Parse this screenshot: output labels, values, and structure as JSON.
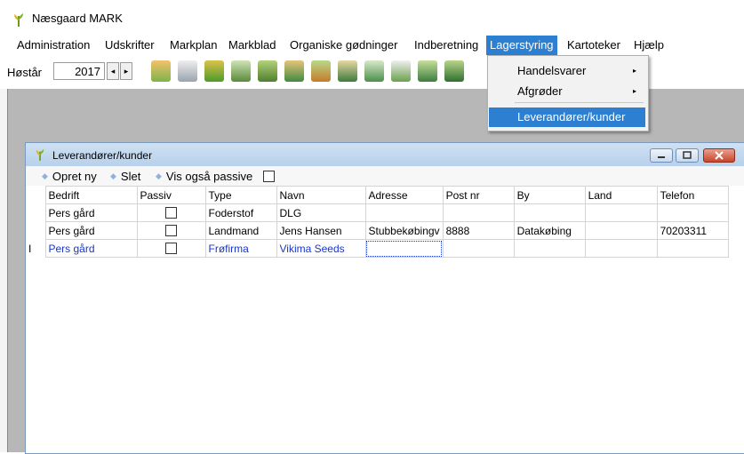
{
  "app": {
    "title": "Næsgaard MARK",
    "icon": "wheat-logo-icon"
  },
  "menu": {
    "items": [
      {
        "label": "Administration"
      },
      {
        "label": "Udskrifter"
      },
      {
        "label": "Markplan"
      },
      {
        "label": "Markblad"
      },
      {
        "label": "Organiske gødninger"
      },
      {
        "label": "Indberetning"
      },
      {
        "label": "Lagerstyring",
        "active": true
      },
      {
        "label": "Kartoteker"
      },
      {
        "label": "Hjælp"
      }
    ]
  },
  "toolbar": {
    "harvest_label": "Høstår",
    "year": "2017",
    "prev": "◂",
    "next": "▸"
  },
  "dropdown": {
    "items": [
      {
        "label": "Handelsvarer",
        "submenu": "▸"
      },
      {
        "label": "Afgrøder",
        "submenu": "▸"
      },
      {
        "label": "Leverandører/kunder",
        "selected": true
      }
    ]
  },
  "window": {
    "title": "Leverandører/kunder",
    "actions": {
      "new": "Opret ny",
      "delete": "Slet",
      "show_passive": "Vis også passive"
    },
    "columns": [
      "Bedrift",
      "Passiv",
      "Type",
      "Navn",
      "Adresse",
      "Post nr",
      "By",
      "Land",
      "Telefon"
    ],
    "current_marker": "I",
    "rows": [
      {
        "bedrift": "Pers gård",
        "type": "Foderstof",
        "navn": "DLG",
        "adresse": "",
        "postnr": "",
        "by": "",
        "land": "",
        "telefon": ""
      },
      {
        "bedrift": "Pers gård",
        "type": "Landmand",
        "navn": "Jens Hansen",
        "adresse": "Stubbekøbingv",
        "postnr": "8888",
        "by": "Datakøbing",
        "land": "",
        "telefon": "70203311"
      },
      {
        "bedrift": "Pers gård",
        "type": "Frøfirma",
        "navn": "Vikima Seeds",
        "adresse": "",
        "postnr": "",
        "by": "",
        "land": "",
        "telefon": ""
      }
    ]
  },
  "colors": {
    "accent": "#2c7fd1",
    "current_row_text": "#1a35c8",
    "workspace": "#b7b7b7"
  }
}
